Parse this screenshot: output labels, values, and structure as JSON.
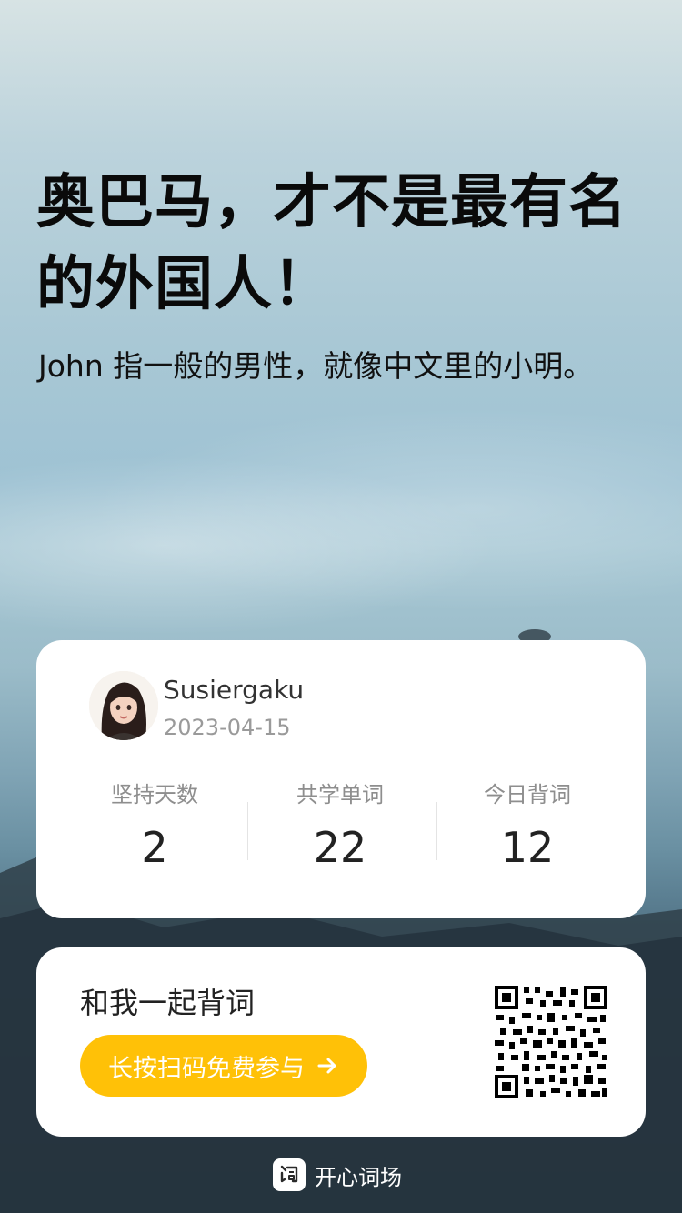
{
  "headline": "奥巴马，才不是最有名的外国人！",
  "subline": "John 指一般的男性，就像中文里的小明。",
  "profile": {
    "username": "Susiergaku",
    "date": "2023-04-15",
    "stats": [
      {
        "label": "坚持天数",
        "value": "2"
      },
      {
        "label": "共学单词",
        "value": "22"
      },
      {
        "label": "今日背词",
        "value": "12"
      }
    ]
  },
  "invite": {
    "title": "和我一起背词",
    "cta": "长按扫码免费参与",
    "cta_color": "#ffc107"
  },
  "brand": {
    "name": "开心词场"
  },
  "icons": {
    "cta_arrow": "arrow-right-icon",
    "brand_logo": "brand-logo-icon",
    "qr": "qr-code-icon"
  }
}
